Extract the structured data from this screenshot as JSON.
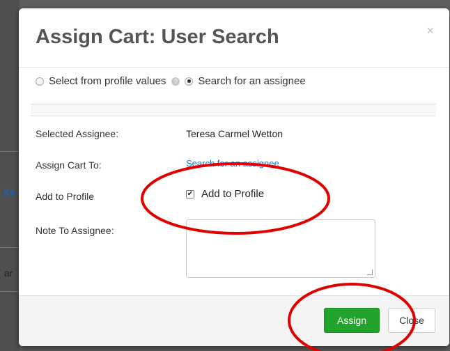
{
  "background": {
    "partial_link_text": "Xe",
    "partial_text": "ar"
  },
  "modal": {
    "title": "Assign Cart: User Search",
    "close_symbol": "×",
    "radio_options": [
      {
        "label": "Select from profile values",
        "selected": false
      },
      {
        "label": "Search for an assignee",
        "selected": true
      }
    ],
    "help_symbol": "?",
    "fields": {
      "selected_assignee_label": "Selected Assignee:",
      "selected_assignee_value": "Teresa Carmel Wetton",
      "assign_cart_to_label": "Assign Cart To:",
      "assign_cart_to_link": "Search for an assignee",
      "add_to_profile_label": "Add to Profile",
      "add_to_profile_checkbox_label": "Add to Profile",
      "add_to_profile_checked": true,
      "note_label": "Note To Assignee:",
      "note_value": ""
    },
    "buttons": {
      "assign": "Assign",
      "close": "Close"
    }
  },
  "colors": {
    "assign_button": "#22a32c",
    "link": "#1a6fc9",
    "annotation": "#e00000"
  },
  "annotations": [
    {
      "shape": "ellipse",
      "color": "#e00000",
      "target": "add-to-profile-checkbox"
    },
    {
      "shape": "ellipse",
      "color": "#e00000",
      "target": "assign-button"
    }
  ]
}
